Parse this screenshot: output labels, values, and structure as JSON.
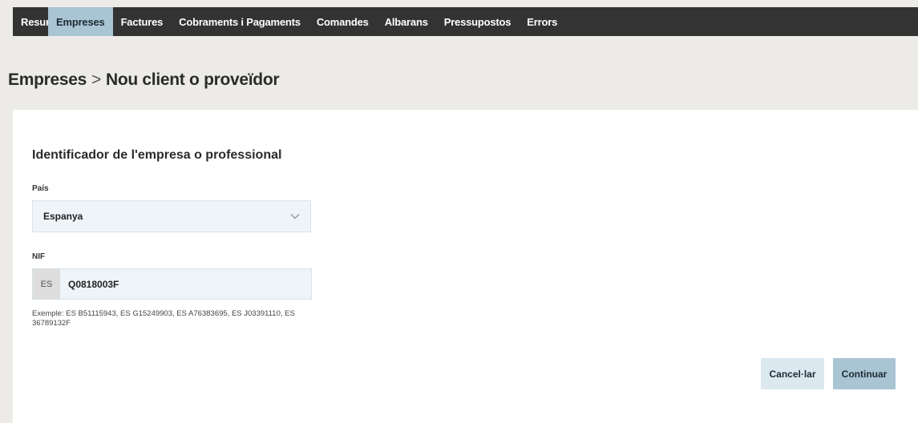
{
  "nav": {
    "items": [
      {
        "label": "Resum",
        "active": false
      },
      {
        "label": "Empreses",
        "active": true
      },
      {
        "label": "Factures",
        "active": false
      },
      {
        "label": "Cobraments i Pagaments",
        "active": false
      },
      {
        "label": "Comandes",
        "active": false
      },
      {
        "label": "Albarans",
        "active": false
      },
      {
        "label": "Pressupostos",
        "active": false
      },
      {
        "label": "Errors",
        "active": false
      }
    ]
  },
  "breadcrumb": {
    "parent": "Empreses",
    "separator": ">",
    "current": "Nou client o proveïdor"
  },
  "form": {
    "section_title": "Identificador de l'empresa o professional",
    "country_label": "País",
    "country_value": "Espanya",
    "nif_label": "NIF",
    "nif_prefix": "ES",
    "nif_value": "Q0818003F",
    "hint": "Exemple: ES B51115943, ES G15249903, ES A76383695, ES J03391110, ES 36789132F"
  },
  "actions": {
    "cancel_label": "Cancel·lar",
    "continue_label": "Continuar"
  },
  "colors": {
    "nav_bg": "#333333",
    "accent": "#a9c4d3",
    "input_bg": "#eef4f8",
    "page_bg": "#ecebe8"
  }
}
